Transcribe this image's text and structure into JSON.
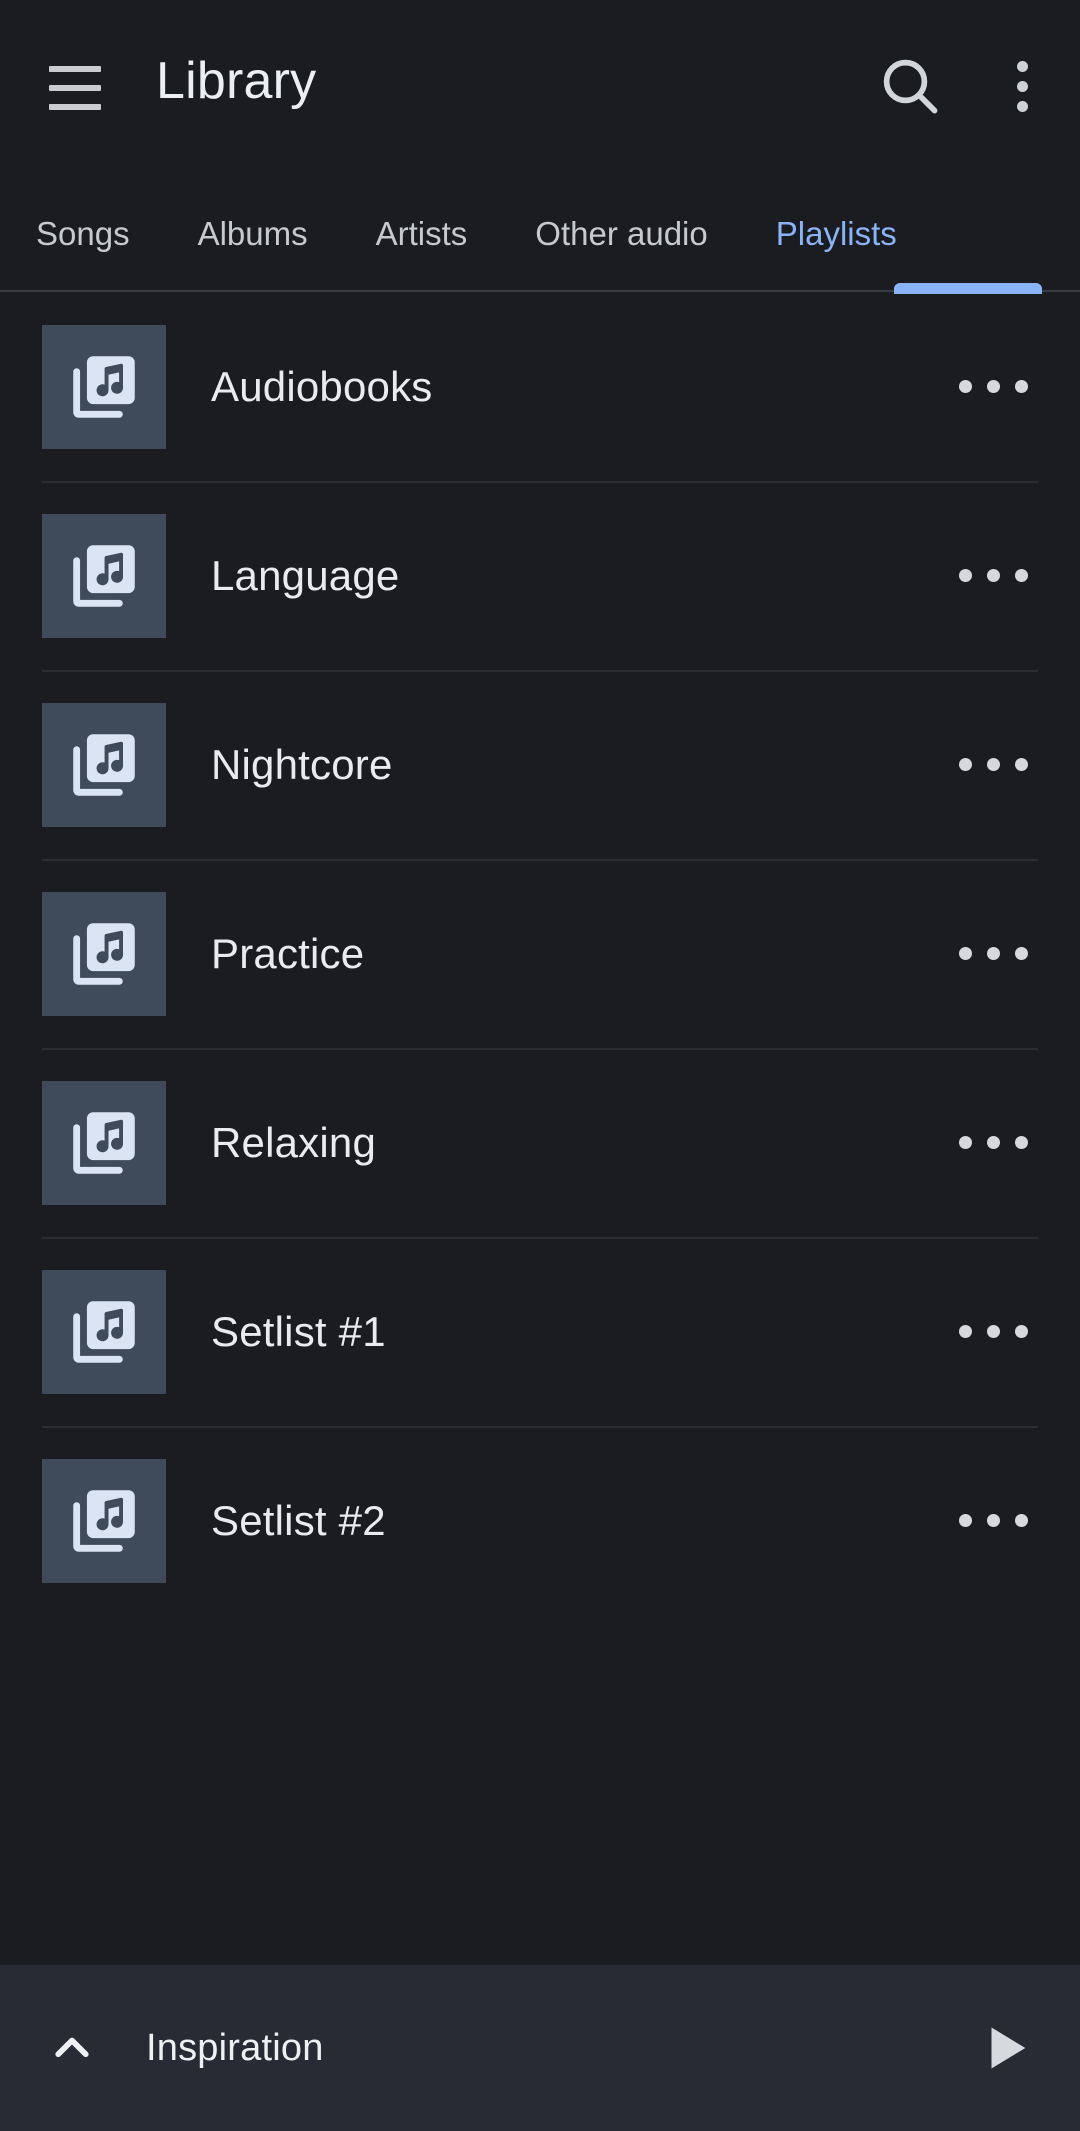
{
  "appbar": {
    "title": "Library",
    "menu_icon": "hamburger-menu-icon",
    "search_icon": "search-icon",
    "overflow_icon": "more-vert-icon"
  },
  "tabs": {
    "items": [
      {
        "label": "Songs",
        "active": false
      },
      {
        "label": "Albums",
        "active": false
      },
      {
        "label": "Artists",
        "active": false
      },
      {
        "label": "Other audio",
        "active": false
      },
      {
        "label": "Playlists",
        "active": true
      }
    ],
    "active_index": 4,
    "accent_color": "#8ab4f8"
  },
  "playlists": {
    "items": [
      {
        "name": "Audiobooks",
        "thumb_icon": "music-library-icon",
        "menu_icon": "more-horiz-icon"
      },
      {
        "name": "Language",
        "thumb_icon": "music-library-icon",
        "menu_icon": "more-horiz-icon"
      },
      {
        "name": "Nightcore",
        "thumb_icon": "music-library-icon",
        "menu_icon": "more-horiz-icon"
      },
      {
        "name": "Practice",
        "thumb_icon": "music-library-icon",
        "menu_icon": "more-horiz-icon"
      },
      {
        "name": "Relaxing",
        "thumb_icon": "music-library-icon",
        "menu_icon": "more-horiz-icon"
      },
      {
        "name": "Setlist #1",
        "thumb_icon": "music-library-icon",
        "menu_icon": "more-horiz-icon"
      },
      {
        "name": "Setlist #2",
        "thumb_icon": "music-library-icon",
        "menu_icon": "more-horiz-icon"
      }
    ],
    "thumb_bg_color": "#3f4a5a",
    "thumb_icon_color": "#dbe4f2"
  },
  "player": {
    "now_playing": "Inspiration",
    "expand_icon": "chevron-up-icon",
    "play_icon": "play-icon",
    "background_color": "#282b33"
  },
  "theme": {
    "background": "#1b1c20",
    "text_primary": "#e9ebed",
    "text_secondary": "#c7cacd",
    "divider": "#2b2d31"
  }
}
